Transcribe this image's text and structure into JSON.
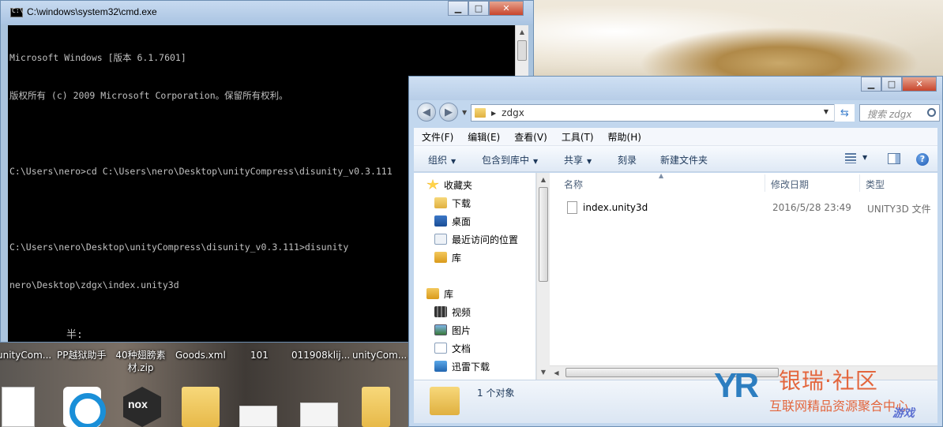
{
  "cmd": {
    "title": "C:\\windows\\system32\\cmd.exe",
    "lines": [
      "Microsoft Windows [版本 6.1.7601]",
      "版权所有 (c) 2009 Microsoft Corporation。保留所有权利。",
      "",
      "C:\\Users\\nero>cd C:\\Users\\nero\\Desktop\\unityCompress\\disunity_v0.3.111",
      "",
      "C:\\Users\\nero\\Desktop\\unityCompress\\disunity_v0.3.111>disunity",
      "nero\\Desktop\\zdgx\\index.unity3d"
    ],
    "ime_indicator": "半:"
  },
  "desktop": {
    "labels": [
      "unityCom...",
      "PP越狱助手",
      "40种翅膀素\n材.zip",
      "Goods.xml",
      "101",
      "011908klij...",
      "unityCom..."
    ],
    "nox_label": "nox"
  },
  "explorer": {
    "address_path": "zdgx",
    "search_placeholder": "搜索 zdgx",
    "menu": [
      "文件(F)",
      "编辑(E)",
      "查看(V)",
      "工具(T)",
      "帮助(H)"
    ],
    "toolbar": {
      "organize": "组织",
      "include_in_library": "包含到库中",
      "share": "共享",
      "burn": "刻录",
      "new_folder": "新建文件夹"
    },
    "nav": {
      "favorites": "收藏夹",
      "favorites_items": [
        "下载",
        "桌面",
        "最近访问的位置",
        "库"
      ],
      "libraries": "库",
      "libraries_items": [
        "视频",
        "图片",
        "文档",
        "迅雷下载"
      ]
    },
    "columns": {
      "name": "名称",
      "modified": "修改日期",
      "type": "类型"
    },
    "files": [
      {
        "name": "index.unity3d",
        "modified": "2016/5/28 23:49",
        "type": "UNITY3D 文件"
      }
    ],
    "status": "1 个对象"
  },
  "watermark": {
    "logo": "YR",
    "title": "银瑞·社区",
    "subtitle": "互联网精品资源聚合中心",
    "game_mark": "游戏"
  }
}
